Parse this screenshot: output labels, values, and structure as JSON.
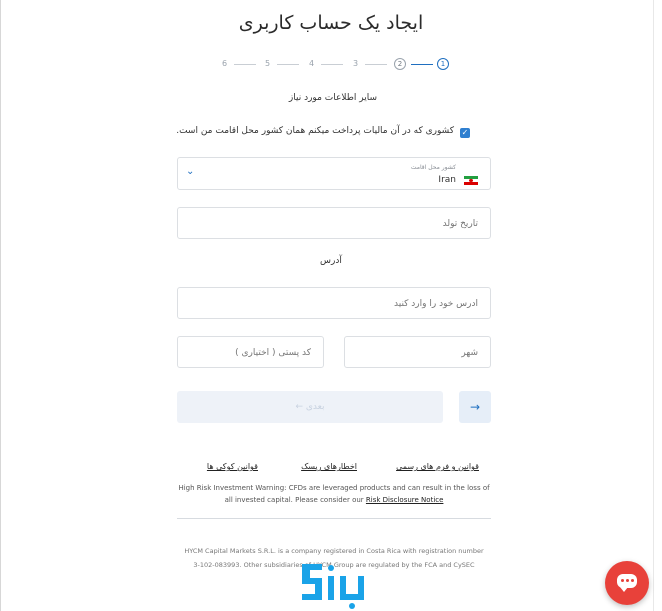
{
  "header": {
    "title": "ایجاد یک حساب کاربری"
  },
  "stepper": {
    "current_step": "1",
    "next_step": "2",
    "other_steps": [
      "3",
      "4",
      "5",
      "6"
    ]
  },
  "form": {
    "section_title": "سایر اطلاعات مورد نیاز",
    "tax_residence_checkbox": {
      "label": "کشوری که در آن مالیات پرداخت میکنم همان کشور محل اقامت من است.",
      "checked": true
    },
    "country": {
      "caption": "کشور محل اقامت",
      "value": "Iran",
      "flag_icon": "iran-flag-icon"
    },
    "birth_date": {
      "placeholder": "تاریخ تولد"
    },
    "address_label": "آدرس",
    "address": {
      "placeholder": "آدرس خود را وارد کنید"
    },
    "city": {
      "placeholder": "شهر"
    },
    "postal_code": {
      "placeholder": "کد پستی ( اختیاری )"
    },
    "next_button_label": "بعدی ←",
    "back_button_icon": "arrow-right-icon"
  },
  "links": {
    "legal": "قوانین و فرم های رسمی",
    "risk": "اخطارهای ریسک",
    "cookies": "قوانین کوکی ها"
  },
  "warning": {
    "text": "High Risk Investment Warning: CFDs are leveraged products and can result in the loss of all invested capital. Please consider our ",
    "link": "Risk Disclosure Notice"
  },
  "footer": {
    "text": "HYCM Capital Markets S.R.L. is a company registered in Costa Rica with registration number 3-102-083993. Other subsidiaries of HYCM Group are regulated by the FCA and CySEC"
  },
  "colors": {
    "accent": "#1f6fc0",
    "chat": "#e8413a",
    "watermark": "#1aa3e8"
  }
}
